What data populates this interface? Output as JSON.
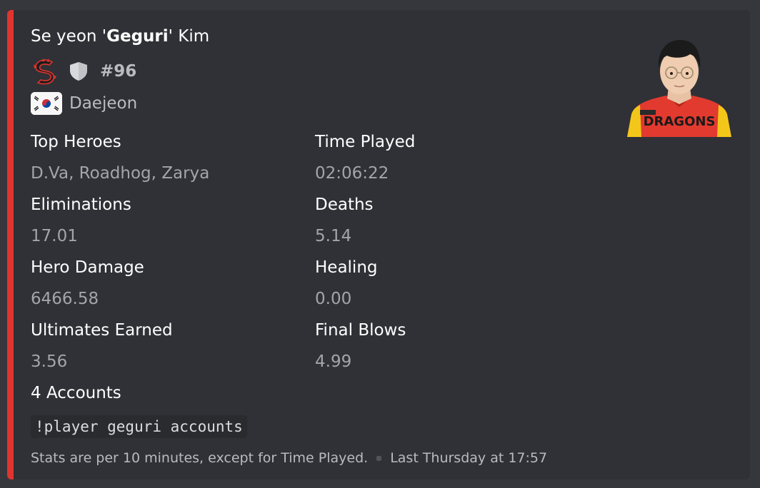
{
  "embed": {
    "accent_color": "#e0342f",
    "author": {
      "first": "Se yeon '",
      "nickname": "Geguri",
      "last": "' Kim"
    },
    "team": {
      "logo_icon": "dragon-logo-icon",
      "role_icon": "shield-icon",
      "ranking": "#96"
    },
    "location": {
      "flag_icon": "south-korea-flag-icon",
      "city": "Daejeon"
    },
    "thumbnail": {
      "description_icon": "player-photo",
      "jersey_text": "DRAGONS"
    },
    "fields": [
      {
        "name": "Top Heroes",
        "value": "D.Va, Roadhog, Zarya"
      },
      {
        "name": "Time Played",
        "value": "02:06:22"
      },
      {
        "name": "Eliminations",
        "value": "17.01"
      },
      {
        "name": "Deaths",
        "value": "5.14"
      },
      {
        "name": "Hero Damage",
        "value": "6466.58"
      },
      {
        "name": "Healing",
        "value": "0.00"
      },
      {
        "name": "Ultimates Earned",
        "value": "3.56"
      },
      {
        "name": "Final Blows",
        "value": "4.99"
      },
      {
        "name": "4 Accounts",
        "value": "!player geguri accounts"
      }
    ],
    "footer": {
      "text": "Stats are per 10 minutes, except for Time Played.",
      "timestamp": "Last Thursday at 17:57"
    }
  }
}
